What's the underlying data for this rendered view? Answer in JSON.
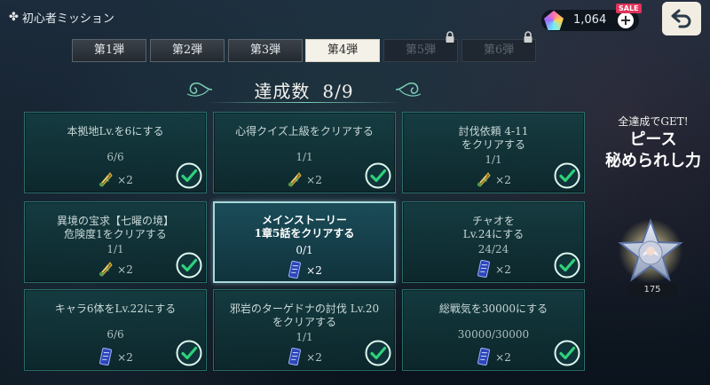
{
  "header": {
    "title": "初心者ミッション",
    "currency_amount": "1,064",
    "sale_badge": "SALE",
    "plus_label": "+"
  },
  "tabs": [
    {
      "label": "第1弾",
      "state": "normal"
    },
    {
      "label": "第2弾",
      "state": "normal"
    },
    {
      "label": "第3弾",
      "state": "normal"
    },
    {
      "label": "第4弾",
      "state": "active"
    },
    {
      "label": "第5弾",
      "state": "locked"
    },
    {
      "label": "第6弾",
      "state": "locked"
    }
  ],
  "summary": {
    "label": "達成数",
    "value": "8/9"
  },
  "missions": [
    {
      "task": "本拠地Lv.を6にする",
      "progress": "6/6",
      "reward_qty": "×2",
      "reward_icon": "gold-scroll-icon",
      "completed": true,
      "highlight": false
    },
    {
      "task": "心得クイズ上級をクリアする",
      "progress": "1/1",
      "reward_qty": "×2",
      "reward_icon": "gold-scroll-icon",
      "completed": true,
      "highlight": false
    },
    {
      "task": "討伐依頼 4-11\nをクリアする",
      "progress": "1/1",
      "reward_qty": "×2",
      "reward_icon": "gold-scroll-icon",
      "completed": true,
      "highlight": false
    },
    {
      "task": "異境の宝求【七曜の境】\n危険度1をクリアする",
      "progress": "1/1",
      "reward_qty": "×2",
      "reward_icon": "gold-scroll-icon",
      "completed": true,
      "highlight": false
    },
    {
      "task": "メインストーリー\n1章5話をクリアする",
      "progress": "0/1",
      "reward_qty": "×2",
      "reward_icon": "blue-ticket-icon",
      "completed": false,
      "highlight": true
    },
    {
      "task": "チャオを\nLv.24にする",
      "progress": "24/24",
      "reward_qty": "×2",
      "reward_icon": "blue-ticket-icon",
      "completed": true,
      "highlight": false
    },
    {
      "task": "キャラ6体をLv.22にする",
      "progress": "6/6",
      "reward_qty": "×2",
      "reward_icon": "blue-ticket-icon",
      "completed": true,
      "highlight": false
    },
    {
      "task": "邪岩のターゲドナの討伐 Lv.20\nをクリアする",
      "progress": "1/1",
      "reward_qty": "×2",
      "reward_icon": "blue-ticket-icon",
      "completed": true,
      "highlight": false
    },
    {
      "task": "総戦気を30000にする",
      "progress": "30000/30000",
      "reward_qty": "×2",
      "reward_icon": "blue-ticket-icon",
      "completed": true,
      "highlight": false
    }
  ],
  "completion_reward": {
    "label": "全達成でGET!",
    "name_line1": "ピース",
    "name_line2": "秘められし力",
    "count": "175"
  },
  "colors": {
    "accent_teal": "#2b6e6a",
    "check_green": "#2fd27a",
    "active_tab": "#f3f1e8"
  }
}
